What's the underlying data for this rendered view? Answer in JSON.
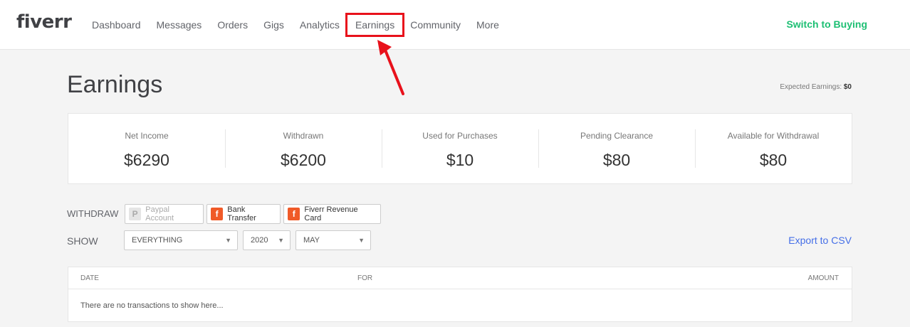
{
  "brand": {
    "logo": "fiverr"
  },
  "nav": {
    "items": [
      "Dashboard",
      "Messages",
      "Orders",
      "Gigs",
      "Analytics",
      "Earnings",
      "Community",
      "More"
    ],
    "active": "Earnings",
    "switch_label": "Switch to Buying"
  },
  "header": {
    "title": "Earnings",
    "expected_label": "Expected Earnings:",
    "expected_value": "$0"
  },
  "stats": [
    {
      "label": "Net Income",
      "value": "$6290"
    },
    {
      "label": "Withdrawn",
      "value": "$6200"
    },
    {
      "label": "Used for Purchases",
      "value": "$10"
    },
    {
      "label": "Pending Clearance",
      "value": "$80"
    },
    {
      "label": "Available for Withdrawal",
      "value": "$80"
    }
  ],
  "withdraw": {
    "label": "WITHDRAW",
    "options": [
      "Paypal Account",
      "Bank Transfer",
      "Fiverr Revenue Card"
    ]
  },
  "filters": {
    "label": "SHOW",
    "type": "EVERYTHING",
    "year": "2020",
    "month": "MAY",
    "export_label": "Export to CSV"
  },
  "table": {
    "columns": [
      "DATE",
      "FOR",
      "AMOUNT"
    ],
    "empty_message": "There are no transactions to show here..."
  },
  "colors": {
    "accent_green": "#1dbf73",
    "highlight_red": "#e8111b",
    "link_blue": "#446ee7",
    "fiverr_orange": "#f05a28"
  }
}
